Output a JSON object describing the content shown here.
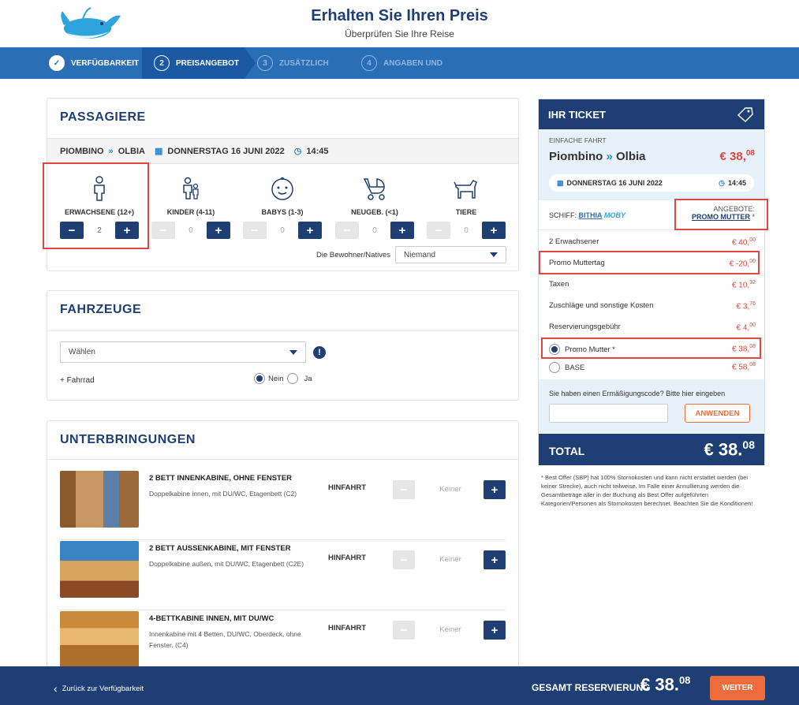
{
  "header": {
    "title": "Erhalten Sie Ihren Preis",
    "subtitle": "Überprüfen Sie Ihre Reise"
  },
  "steps": [
    {
      "num": "",
      "label": "VERFÜGBARKEIT"
    },
    {
      "num": "2",
      "label": "PREISANGEBOT"
    },
    {
      "num": "3",
      "label": "ZUSÄTZLICH"
    },
    {
      "num": "4",
      "label": "ANGABEN UND"
    }
  ],
  "passengers": {
    "heading": "PASSAGIERE",
    "route_from": "PIOMBINO",
    "route_to": "OLBIA",
    "date": "DONNERSTAG 16 JUNI 2022",
    "time": "14:45",
    "types": [
      {
        "label": "ERWACHSENE (12+)",
        "value": "2",
        "icon": "adult-icon"
      },
      {
        "label": "KINDER (4-11)",
        "value": "0",
        "icon": "child-icon"
      },
      {
        "label": "BABYS (1-3)",
        "value": "0",
        "icon": "baby-face-icon"
      },
      {
        "label": "NEUGEB. (<1)",
        "value": "0",
        "icon": "stroller-icon"
      },
      {
        "label": "TIERE",
        "value": "0",
        "icon": "dog-icon"
      }
    ],
    "residents_label": "Die Bewohner/Natives",
    "residents_value": "Niemand"
  },
  "vehicles": {
    "heading": "FAHRZEUGE",
    "select_value": "Wählen",
    "bike_label": "+ Fahrrad",
    "no_label": "Nein",
    "yes_label": "Ja"
  },
  "accommodations": {
    "heading": "UNTERBRINGUNGEN",
    "items": [
      {
        "name": "2 BETT INNENKABINE, OHNE FENSTER",
        "desc": "Doppelkabine innen, mit DU/WC, Etagenbett (C2)",
        "direction": "HINFAHRT",
        "value": "Keiner"
      },
      {
        "name": "2 BETT AUSSENKABINE, MIT FENSTER",
        "desc": "Doppelkabine außen, mit DU/WC, Etagenbett (C2E)",
        "direction": "HINFAHRT",
        "value": "Keiner"
      },
      {
        "name": "4-BETTKABINE INNEN, MIT DU/WC",
        "desc": "Innenkabine mit 4 Betten, DU/WC, Oberdeck, ohne Fenster. (C4)",
        "direction": "HINFAHRT",
        "value": "Keiner"
      }
    ]
  },
  "ticket": {
    "heading": "IHR TICKET",
    "trip_type": "EINFACHE FAHRT",
    "from": "Piombino",
    "to": "Olbia",
    "price_main": "€ 38,",
    "price_cents": "08",
    "date": "DONNERSTAG 16 JUNI 2022",
    "time": "14:45",
    "ship_label": "SCHIFF:",
    "ship_name": "BITHIA",
    "ship_brand": "MOBY",
    "offers_label": "ANGEBOTE:",
    "offer_name": "PROMO MUTTER",
    "offer_star": "*",
    "lines": [
      {
        "label": "2 Erwachsener",
        "amount": "€ 40,",
        "cents": "00"
      },
      {
        "label": "Promo Muttertag",
        "amount": "€ -20,",
        "cents": "00"
      },
      {
        "label": "Taxen",
        "amount": "€ 10,",
        "cents": "32"
      },
      {
        "label": "Zuschläge und sonstige Kosten",
        "amount": "€ 3,",
        "cents": "76"
      },
      {
        "label": "Reservierungsgebühr",
        "amount": "€ 4,",
        "cents": "00"
      }
    ],
    "fares": [
      {
        "label": "Promo Mutter *",
        "amount": "€ 38,",
        "cents": "08",
        "selected": true
      },
      {
        "label": "BASE",
        "amount": "€ 58,",
        "cents": "08",
        "selected": false
      }
    ],
    "discount_prompt": "Sie haben einen Ermäßigungscode? Bitte hier eingeben",
    "discount_placeholder": "",
    "apply_label": "ANWENDEN",
    "total_label": "TOTAL",
    "total_main": "€ 38.",
    "total_cents": "08",
    "footnote": "* Best Offer (SBP) hat 100% Stornokosten und kann nicht erstattet werden (bei keiner Strecke), auch nicht teilweise. Im Falle einer Annullierung werden die Gesamtbeträge aller in der Buchung als Best Offer aufgeführten Kategorien/Personen als Stornokosten berechnet. Beachten Sie die Konditionen!"
  },
  "footer": {
    "back_label": "Zurück zur Verfügbarkeit",
    "total_label": "GESAMT RESERVIERUNG",
    "total_main": "€ 38.",
    "total_cents": "08",
    "next_label": "WEITER"
  },
  "colors": {
    "navy": "#1f3f74",
    "blue": "#2a6fb6",
    "orange": "#ee6c3b",
    "red": "#e0473e"
  }
}
